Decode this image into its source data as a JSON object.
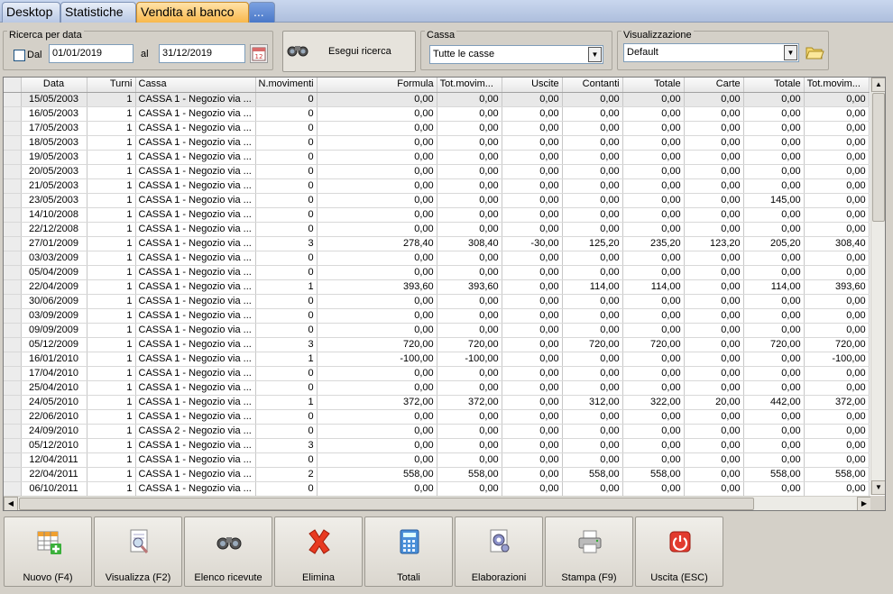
{
  "tabs": [
    {
      "label": "Desktop"
    },
    {
      "label": "Statistiche"
    },
    {
      "label": "Vendita al banco"
    },
    {
      "label": "..."
    }
  ],
  "search": {
    "group_title": "Ricerca per data",
    "dal_label": "Dal",
    "al_label": "al",
    "from_date": "01/01/2019",
    "to_date": "31/12/2019",
    "button_label": "Esegui ricerca"
  },
  "cassa": {
    "group_title": "Cassa",
    "selected": "Tutte le casse"
  },
  "visualizzazione": {
    "group_title": "Visualizzazione",
    "selected": "Default"
  },
  "grid": {
    "columns": [
      "Data",
      "Turni",
      "Cassa",
      "N.movimenti",
      "Formula",
      "Tot.movim...",
      "Uscite",
      "Contanti",
      "Totale",
      "Carte",
      "Totale",
      "Tot.movim..."
    ],
    "rows": [
      [
        "15/05/2003",
        "1",
        "CASSA 1 - Negozio via ...",
        "0",
        "0,00",
        "0,00",
        "0,00",
        "0,00",
        "0,00",
        "0,00",
        "0,00",
        "0,00"
      ],
      [
        "16/05/2003",
        "1",
        "CASSA 1 - Negozio via ...",
        "0",
        "0,00",
        "0,00",
        "0,00",
        "0,00",
        "0,00",
        "0,00",
        "0,00",
        "0,00"
      ],
      [
        "17/05/2003",
        "1",
        "CASSA 1 - Negozio via ...",
        "0",
        "0,00",
        "0,00",
        "0,00",
        "0,00",
        "0,00",
        "0,00",
        "0,00",
        "0,00"
      ],
      [
        "18/05/2003",
        "1",
        "CASSA 1 - Negozio via ...",
        "0",
        "0,00",
        "0,00",
        "0,00",
        "0,00",
        "0,00",
        "0,00",
        "0,00",
        "0,00"
      ],
      [
        "19/05/2003",
        "1",
        "CASSA 1 - Negozio via ...",
        "0",
        "0,00",
        "0,00",
        "0,00",
        "0,00",
        "0,00",
        "0,00",
        "0,00",
        "0,00"
      ],
      [
        "20/05/2003",
        "1",
        "CASSA 1 - Negozio via ...",
        "0",
        "0,00",
        "0,00",
        "0,00",
        "0,00",
        "0,00",
        "0,00",
        "0,00",
        "0,00"
      ],
      [
        "21/05/2003",
        "1",
        "CASSA 1 - Negozio via ...",
        "0",
        "0,00",
        "0,00",
        "0,00",
        "0,00",
        "0,00",
        "0,00",
        "0,00",
        "0,00"
      ],
      [
        "23/05/2003",
        "1",
        "CASSA 1 - Negozio via ...",
        "0",
        "0,00",
        "0,00",
        "0,00",
        "0,00",
        "0,00",
        "0,00",
        "145,00",
        "0,00"
      ],
      [
        "14/10/2008",
        "1",
        "CASSA 1 - Negozio via ...",
        "0",
        "0,00",
        "0,00",
        "0,00",
        "0,00",
        "0,00",
        "0,00",
        "0,00",
        "0,00"
      ],
      [
        "22/12/2008",
        "1",
        "CASSA 1 - Negozio via ...",
        "0",
        "0,00",
        "0,00",
        "0,00",
        "0,00",
        "0,00",
        "0,00",
        "0,00",
        "0,00"
      ],
      [
        "27/01/2009",
        "1",
        "CASSA 1 - Negozio via ...",
        "3",
        "278,40",
        "308,40",
        "-30,00",
        "125,20",
        "235,20",
        "123,20",
        "205,20",
        "308,40"
      ],
      [
        "03/03/2009",
        "1",
        "CASSA 1 - Negozio via ...",
        "0",
        "0,00",
        "0,00",
        "0,00",
        "0,00",
        "0,00",
        "0,00",
        "0,00",
        "0,00"
      ],
      [
        "05/04/2009",
        "1",
        "CASSA 1 - Negozio via ...",
        "0",
        "0,00",
        "0,00",
        "0,00",
        "0,00",
        "0,00",
        "0,00",
        "0,00",
        "0,00"
      ],
      [
        "22/04/2009",
        "1",
        "CASSA 1 - Negozio via ...",
        "1",
        "393,60",
        "393,60",
        "0,00",
        "114,00",
        "114,00",
        "0,00",
        "114,00",
        "393,60"
      ],
      [
        "30/06/2009",
        "1",
        "CASSA 1 - Negozio via ...",
        "0",
        "0,00",
        "0,00",
        "0,00",
        "0,00",
        "0,00",
        "0,00",
        "0,00",
        "0,00"
      ],
      [
        "03/09/2009",
        "1",
        "CASSA 1 - Negozio via ...",
        "0",
        "0,00",
        "0,00",
        "0,00",
        "0,00",
        "0,00",
        "0,00",
        "0,00",
        "0,00"
      ],
      [
        "09/09/2009",
        "1",
        "CASSA 1 - Negozio via ...",
        "0",
        "0,00",
        "0,00",
        "0,00",
        "0,00",
        "0,00",
        "0,00",
        "0,00",
        "0,00"
      ],
      [
        "05/12/2009",
        "1",
        "CASSA 1 - Negozio via ...",
        "3",
        "720,00",
        "720,00",
        "0,00",
        "720,00",
        "720,00",
        "0,00",
        "720,00",
        "720,00"
      ],
      [
        "16/01/2010",
        "1",
        "CASSA 1 - Negozio via ...",
        "1",
        "-100,00",
        "-100,00",
        "0,00",
        "0,00",
        "0,00",
        "0,00",
        "0,00",
        "-100,00"
      ],
      [
        "17/04/2010",
        "1",
        "CASSA 1 - Negozio via ...",
        "0",
        "0,00",
        "0,00",
        "0,00",
        "0,00",
        "0,00",
        "0,00",
        "0,00",
        "0,00"
      ],
      [
        "25/04/2010",
        "1",
        "CASSA 1 - Negozio via ...",
        "0",
        "0,00",
        "0,00",
        "0,00",
        "0,00",
        "0,00",
        "0,00",
        "0,00",
        "0,00"
      ],
      [
        "24/05/2010",
        "1",
        "CASSA 1 - Negozio via ...",
        "1",
        "372,00",
        "372,00",
        "0,00",
        "312,00",
        "322,00",
        "20,00",
        "442,00",
        "372,00"
      ],
      [
        "22/06/2010",
        "1",
        "CASSA 1 - Negozio via ...",
        "0",
        "0,00",
        "0,00",
        "0,00",
        "0,00",
        "0,00",
        "0,00",
        "0,00",
        "0,00"
      ],
      [
        "24/09/2010",
        "1",
        "CASSA 2 - Negozio via ...",
        "0",
        "0,00",
        "0,00",
        "0,00",
        "0,00",
        "0,00",
        "0,00",
        "0,00",
        "0,00"
      ],
      [
        "05/12/2010",
        "1",
        "CASSA 1 - Negozio via ...",
        "3",
        "0,00",
        "0,00",
        "0,00",
        "0,00",
        "0,00",
        "0,00",
        "0,00",
        "0,00"
      ],
      [
        "12/04/2011",
        "1",
        "CASSA 1 - Negozio via ...",
        "0",
        "0,00",
        "0,00",
        "0,00",
        "0,00",
        "0,00",
        "0,00",
        "0,00",
        "0,00"
      ],
      [
        "22/04/2011",
        "1",
        "CASSA 1 - Negozio via ...",
        "2",
        "558,00",
        "558,00",
        "0,00",
        "558,00",
        "558,00",
        "0,00",
        "558,00",
        "558,00"
      ],
      [
        "06/10/2011",
        "1",
        "CASSA 1 - Negozio via ...",
        "0",
        "0,00",
        "0,00",
        "0,00",
        "0,00",
        "0,00",
        "0,00",
        "0,00",
        "0,00"
      ]
    ]
  },
  "toolbar": {
    "buttons": [
      {
        "label": "Nuovo (F4)",
        "icon": "new-grid-icon"
      },
      {
        "label": "Visualizza (F2)",
        "icon": "view-document-icon"
      },
      {
        "label": "Elenco ricevute",
        "icon": "binoculars-icon"
      },
      {
        "label": "Elimina",
        "icon": "delete-x-icon"
      },
      {
        "label": "Totali",
        "icon": "calculator-icon"
      },
      {
        "label": "Elaborazioni",
        "icon": "gear-document-icon"
      },
      {
        "label": "Stampa (F9)",
        "icon": "printer-icon"
      },
      {
        "label": "Uscita (ESC)",
        "icon": "power-icon"
      }
    ]
  }
}
